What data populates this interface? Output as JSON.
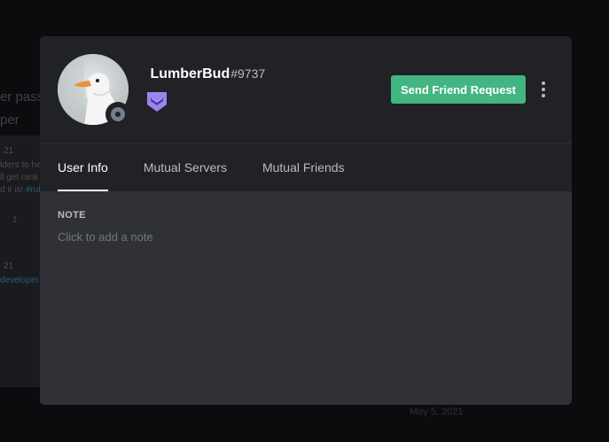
{
  "background": {
    "text_1": "er pass",
    "text_2": "per",
    "snippet_1": "21",
    "snippet_2": "lders to he",
    "snippet_3": "ll get rank",
    "snippet_4": "d it is!",
    "snippet_5": "#rul",
    "snippet_6": "1",
    "snippet_7": "21",
    "snippet_8": "developer",
    "date": "May 5, 2021"
  },
  "profile": {
    "username": "⁣ LumberBud⁣",
    "discriminator": "#9737",
    "status": "offline",
    "badge": "hypesquad-balance-badge",
    "send_request_label": "Send Friend Request"
  },
  "tabs": [
    {
      "label": "User Info",
      "active": true
    },
    {
      "label": "Mutual Servers",
      "active": false
    },
    {
      "label": "Mutual Friends",
      "active": false
    }
  ],
  "note": {
    "heading": "NOTE",
    "placeholder": "Click to add a note"
  },
  "colors": {
    "accent_green": "#43b581",
    "badge_purple": "#9c84ef",
    "modal_bg": "#2f3136",
    "header_bg": "#202225"
  }
}
